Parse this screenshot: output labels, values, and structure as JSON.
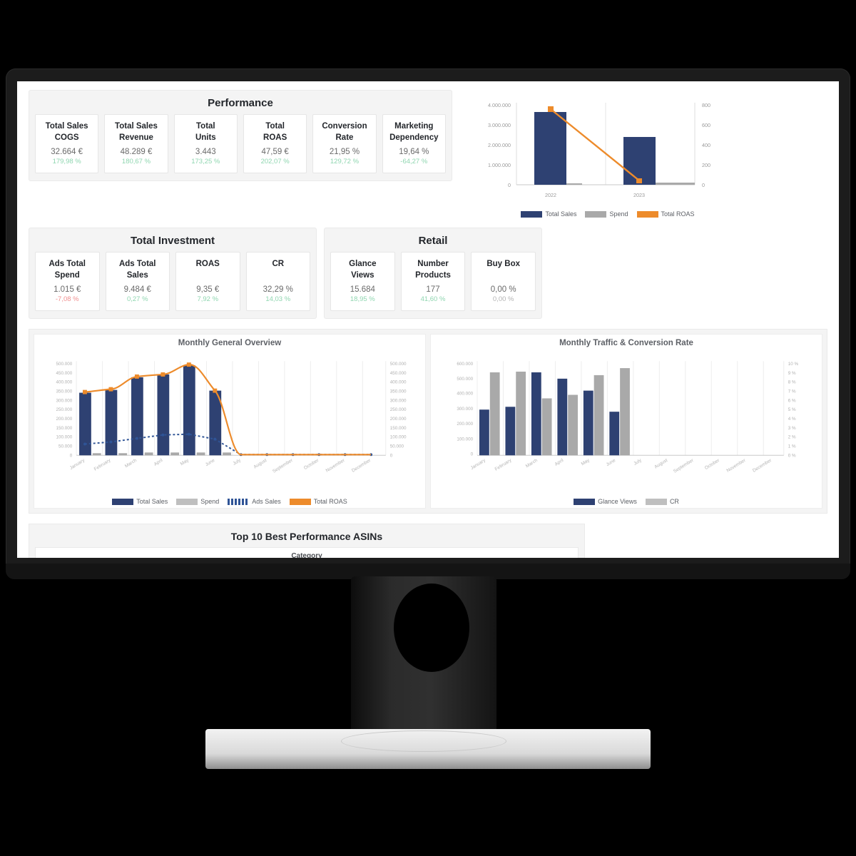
{
  "device": {
    "type": "desktop-monitor"
  },
  "dashboard": {
    "performance": {
      "title": "Performance",
      "cards": [
        {
          "label_line1": "Total Sales",
          "label_line2": "COGS",
          "value": "32.664 €",
          "delta": "179,98 %",
          "delta_state": "pos"
        },
        {
          "label_line1": "Total Sales",
          "label_line2": "Revenue",
          "value": "48.289 €",
          "delta": "180,67 %",
          "delta_state": "pos"
        },
        {
          "label_line1": "Total",
          "label_line2": "Units",
          "value": "3.443",
          "delta": "173,25 %",
          "delta_state": "pos"
        },
        {
          "label_line1": "Total",
          "label_line2": "ROAS",
          "value": "47,59 €",
          "delta": "202,07 %",
          "delta_state": "pos"
        },
        {
          "label_line1": "Conversion",
          "label_line2": "Rate",
          "value": "21,95 %",
          "delta": "129,72 %",
          "delta_state": "pos"
        },
        {
          "label_line1": "Marketing",
          "label_line2": "Dependency",
          "value": "19,64 %",
          "delta": "-64,27 %",
          "delta_state": "pos"
        }
      ]
    },
    "total_investment": {
      "title": "Total Investment",
      "cards": [
        {
          "label_line1": "Ads Total",
          "label_line2": "Spend",
          "value": "1.015 €",
          "delta": "-7,08 %",
          "delta_state": "neg"
        },
        {
          "label_line1": "Ads Total",
          "label_line2": "Sales",
          "value": "9.484 €",
          "delta": "0,27 %",
          "delta_state": "pos"
        },
        {
          "label_line1": "ROAS",
          "label_line2": "",
          "value": "9,35 €",
          "delta": "7,92 %",
          "delta_state": "pos"
        },
        {
          "label_line1": "CR",
          "label_line2": "",
          "value": "32,29 %",
          "delta": "14,03 %",
          "delta_state": "pos"
        }
      ]
    },
    "retail": {
      "title": "Retail",
      "cards": [
        {
          "label_line1": "Glance",
          "label_line2": "Views",
          "value": "15.684",
          "delta": "18,95 %",
          "delta_state": "pos"
        },
        {
          "label_line1": "Number",
          "label_line2": "Products",
          "value": "177",
          "delta": "41,60 %",
          "delta_state": "pos"
        },
        {
          "label_line1": "Buy Box",
          "label_line2": "",
          "value": "0,00 %",
          "delta": "0,00 %",
          "delta_state": "zero"
        }
      ]
    },
    "bottom": {
      "title": "Top 10 Best Performance ASINs",
      "column_peek": "Category"
    }
  },
  "colors": {
    "navy": "#2E4172",
    "gray": "#A9A9A9",
    "orange": "#ED8B2B",
    "ads_blue": "#2F5496",
    "panel_bg": "#f4f4f4"
  },
  "chart_data": [
    {
      "id": "yearly-overview",
      "type": "bar",
      "title": "",
      "categories": [
        "2022",
        "2023"
      ],
      "series": [
        {
          "name": "Total Sales",
          "type": "bar",
          "axis": "left",
          "values": [
            3550000,
            2320000
          ]
        },
        {
          "name": "Spend",
          "type": "bar",
          "axis": "left",
          "values": [
            12000,
            26000
          ]
        },
        {
          "name": "Total ROAS",
          "type": "line",
          "axis": "right",
          "values": [
            735,
            45
          ]
        }
      ],
      "ylabel": "",
      "xlabel": "",
      "ylim": [
        0,
        4000000
      ],
      "yticks": [
        "0",
        "1.000.000",
        "2.000.000",
        "3.000.000",
        "4.000.000"
      ],
      "y2lim": [
        0,
        800
      ],
      "y2ticks": [
        "0",
        "200",
        "400",
        "600",
        "800"
      ],
      "grid": true,
      "legend": [
        "Total Sales",
        "Spend",
        "Total ROAS"
      ],
      "legend_position": "bottom"
    },
    {
      "id": "monthly-general-overview",
      "type": "bar",
      "title": "Monthly General Overview",
      "categories": [
        "January",
        "February",
        "March",
        "April",
        "May",
        "June",
        "July",
        "August",
        "September",
        "October",
        "November",
        "December"
      ],
      "series": [
        {
          "name": "Total Sales",
          "type": "bar",
          "axis": "left",
          "values": [
            332000,
            348000,
            415000,
            430000,
            480000,
            345000,
            0,
            0,
            0,
            0,
            0,
            0
          ]
        },
        {
          "name": "Spend",
          "type": "bar",
          "axis": "left",
          "values": [
            4000,
            4500,
            5200,
            5400,
            5600,
            5000,
            0,
            0,
            0,
            0,
            0,
            0
          ]
        },
        {
          "name": "Ads Sales",
          "type": "dotted-line",
          "axis": "left",
          "values": [
            62000,
            72000,
            92000,
            110000,
            112000,
            88000,
            2000,
            2000,
            2000,
            2000,
            2000,
            2000
          ]
        },
        {
          "name": "Total ROAS",
          "type": "line",
          "axis": "right",
          "values": [
            335000,
            348000,
            418000,
            428000,
            482000,
            345000,
            2000,
            2000,
            2000,
            2000,
            2000,
            2000
          ]
        }
      ],
      "ylim": [
        0,
        500000
      ],
      "yticks": [
        "0",
        "50.000",
        "100.000",
        "150.000",
        "200.000",
        "250.000",
        "300.000",
        "350.000",
        "400.000",
        "450.000",
        "500.000"
      ],
      "y2lim": [
        0,
        500000
      ],
      "y2ticks": [
        "0",
        "50.000",
        "100.000",
        "150.000",
        "200.000",
        "250.000",
        "300.000",
        "350.000",
        "400.000",
        "450.000",
        "500.000"
      ],
      "grid": true,
      "legend": [
        "Total Sales",
        "Spend",
        "Ads Sales",
        "Total ROAS"
      ],
      "legend_position": "bottom"
    },
    {
      "id": "monthly-traffic-conversion",
      "type": "bar",
      "title": "Monthly Traffic & Conversion Rate",
      "categories": [
        "January",
        "February",
        "March",
        "April",
        "May",
        "June",
        "July",
        "August",
        "September",
        "October",
        "November",
        "December"
      ],
      "series": [
        {
          "name": "Glance Views",
          "type": "bar",
          "axis": "left",
          "values": [
            290000,
            307000,
            530000,
            490000,
            415000,
            280000,
            0,
            0,
            0,
            0,
            0,
            0
          ]
        },
        {
          "name": "CR",
          "type": "bar",
          "axis": "right",
          "values": [
            8.8,
            8.9,
            6.0,
            6.4,
            8.5,
            9.3,
            0,
            0,
            0,
            0,
            0,
            0
          ]
        }
      ],
      "ylim": [
        0,
        600000
      ],
      "yticks": [
        "0",
        "100.000",
        "200.000",
        "300.000",
        "400.000",
        "500.000",
        "600.000"
      ],
      "y2lim": [
        0,
        10
      ],
      "y2ticks": [
        "0 %",
        "1 %",
        "2 %",
        "3 %",
        "4 %",
        "5 %",
        "6 %",
        "7 %",
        "8 %",
        "9 %",
        "10 %"
      ],
      "grid": true,
      "legend": [
        "Glance Views",
        "CR"
      ],
      "legend_position": "bottom"
    }
  ]
}
